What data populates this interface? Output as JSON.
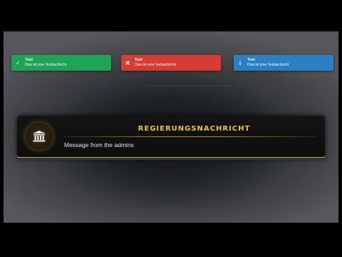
{
  "toasts": [
    {
      "type": "success",
      "title": "Test",
      "message": "Dies ist eine Testnachricht",
      "icon": "check-icon",
      "color": "#1fa35a"
    },
    {
      "type": "error",
      "title": "Test",
      "message": "Dies ist eine Testnachricht",
      "icon": "x-icon",
      "color": "#d63b34"
    },
    {
      "type": "info",
      "title": "Test",
      "message": "Dies ist eine Testnachricht",
      "icon": "info-icon",
      "color": "#2d7fc4"
    }
  ],
  "government": {
    "title": "REGIERUNGSNACHRICHT",
    "message": "Message from the admins",
    "icon": "government-building-icon",
    "accent": "#e8c33a"
  }
}
